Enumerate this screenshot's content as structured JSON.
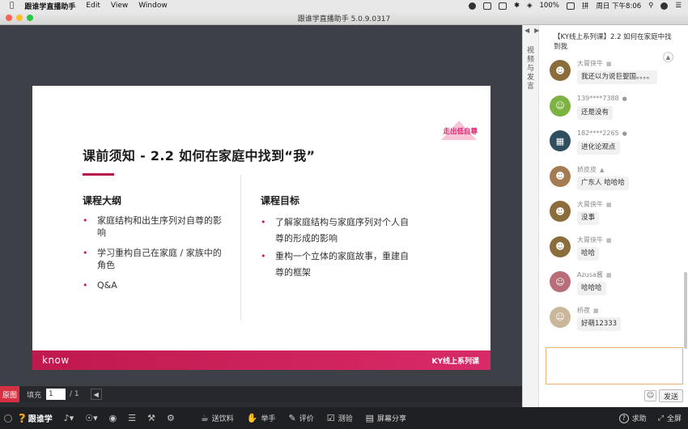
{
  "menubar": {
    "app_name": "跟谁学直播助手",
    "menus": [
      "Edit",
      "View",
      "Window"
    ],
    "battery": "100%",
    "input_method": "拼",
    "clock": "周日 下午8:06"
  },
  "window": {
    "title": "跟谁学直播助手 5.0.9.0317"
  },
  "slide": {
    "title": "课前须知 - 2.2 如何在家庭中找到“我”",
    "logo_text": "走出低自尊",
    "left_heading": "课程大纲",
    "left_items": [
      "家庭结构和出生序列对自尊的影响",
      "学习重构自己在家庭 / 家族中的角色",
      "Q&A"
    ],
    "right_heading": "课程目标",
    "right_items": [
      "了解家庭结构与家庭序列对个人自尊的形成的影响",
      "重构一个立体的家庭故事，重建自尊的框架"
    ],
    "footer_brand": "know",
    "footer_series": "KY线上系列课"
  },
  "pagestrip": {
    "orig_label": "原图",
    "fill_label": "填充",
    "current_page": "1",
    "total_pages": "/ 1"
  },
  "chat": {
    "nav_label": "视频与发言",
    "title": "【KY线上系列课】2.2 如何在家庭中找到我",
    "messages": [
      {
        "user": "大胃侠牛",
        "text": "我还以为说巨婴国。。。。",
        "avatar_color": "#8a6d3b"
      },
      {
        "user": "139****7388",
        "text": "还是没有",
        "avatar_color": "#7cb342"
      },
      {
        "user": "182****2265",
        "text": "进化论观点",
        "avatar_color": "#2f4f5f"
      },
      {
        "user": "娇皮皮",
        "text": "广东人 哈哈哈",
        "avatar_color": "#a57c52"
      },
      {
        "user": "大胃侠牛",
        "text": "没事",
        "avatar_color": "#8a6d3b"
      },
      {
        "user": "大胃侠牛",
        "text": "哈哈",
        "avatar_color": "#8a6d3b"
      },
      {
        "user": "Azusa酱",
        "text": "哈哈哈",
        "avatar_color": "#b76e79"
      },
      {
        "user": "桥夜",
        "text": "好萌12333",
        "avatar_color": "#c9b79c"
      }
    ],
    "send_label": "发送"
  },
  "toolbar": {
    "logo_text": "跟谁学",
    "actions": [
      "送饮料",
      "举手",
      "评价",
      "测验",
      "屏幕分享"
    ],
    "help_label": "求助",
    "fullscreen_label": "全屏"
  }
}
